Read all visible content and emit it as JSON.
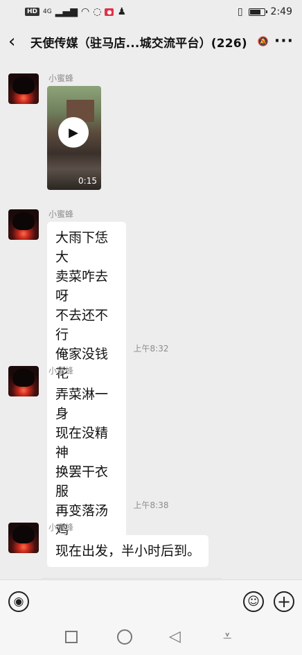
{
  "status_bar": {
    "hd": "HD",
    "network": "4G",
    "time": "2:49"
  },
  "header": {
    "title": "天使传媒（驻马店...城交流平台）(226)",
    "more_label": "···"
  },
  "messages": [
    {
      "sender": "小蜜蜂",
      "type": "video",
      "duration": "0:15"
    },
    {
      "sender": "小蜜蜂",
      "type": "text",
      "lines": [
        "大雨下恁大",
        "卖菜咋去呀",
        "不去还不行",
        "俺家没钱花"
      ]
    },
    {
      "sender": "小蜜蜂",
      "type": "text",
      "lines": [
        "弄菜淋一身",
        "现在没精神",
        "换罢干衣服",
        "再变落汤鸡"
      ]
    },
    {
      "sender": "小蜜蜂",
      "type": "text",
      "lines": [
        "现在出发，半小时后到。"
      ]
    }
  ],
  "time_labels": [
    "上午8:32",
    "上午8:38"
  ],
  "icons": {
    "back": "chevron-left-icon",
    "mute": "bell-muted-icon",
    "voice": "voice-icon",
    "emoji": "smile-icon",
    "plus": "plus-icon"
  }
}
